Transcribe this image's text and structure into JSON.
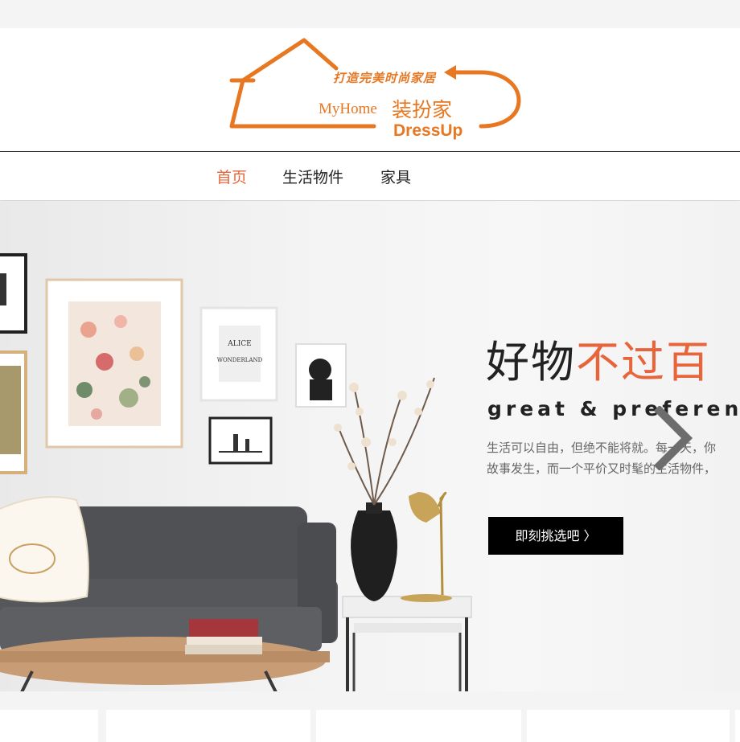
{
  "logo": {
    "tagline": "打造完美时尚家居",
    "myhome": "MyHome",
    "cn_name": "装扮家",
    "dressup": "DressUp"
  },
  "nav": {
    "items": [
      {
        "label": "首页",
        "active": true
      },
      {
        "label": "生活物件",
        "active": false
      },
      {
        "label": "家具",
        "active": false
      }
    ]
  },
  "hero": {
    "headline_part1": "好物",
    "headline_part2": "不过百",
    "subhead": "great & preferential",
    "desc_line1": "生活可以自由，但绝不能将就。每一天，你",
    "desc_line2": "故事发生，而一个平价又时髦的生活物件，",
    "cta_label": "即刻挑选吧 〉"
  },
  "icons": {
    "next": "chevron-right-icon"
  },
  "colors": {
    "brand_orange": "#e87722",
    "accent": "#e8643b",
    "cta_bg": "#000000"
  }
}
